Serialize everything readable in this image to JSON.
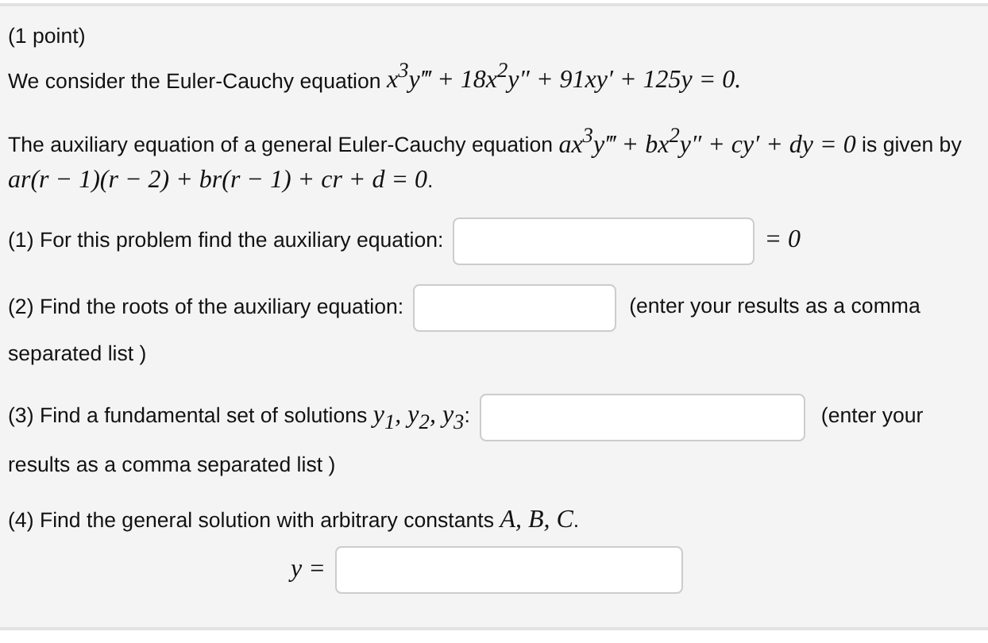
{
  "header": "(1 point)",
  "paragraphs": [
    {
      "parts": [
        {
          "kind": "text",
          "text": "We consider the Euler-Cauchy equation "
        },
        {
          "kind": "math",
          "text": "x$^{3}$y‴ + 18x$^{2}$y″ + 91xy′ + 125y = 0."
        }
      ]
    },
    {
      "parts": [
        {
          "kind": "text",
          "text": "The auxiliary equation of a general Euler-Cauchy equation "
        },
        {
          "kind": "math",
          "text": "ax$^{3}$y‴ + bx$^{2}$y″ + cy′ + dy = 0"
        },
        {
          "kind": "text",
          "text": " is given by "
        },
        {
          "kind": "math",
          "text": "ar(r − 1)(r − 2) + br(r − 1) + cr + d = 0"
        },
        {
          "kind": "text",
          "text": "."
        }
      ]
    }
  ],
  "questions": [
    {
      "kind": "inline",
      "label": [
        {
          "kind": "text",
          "text": "(1) For this problem find the auxiliary equation:"
        }
      ],
      "suffix": {
        "kind": "math",
        "text": "= 0"
      }
    },
    {
      "kind": "inline",
      "label": [
        {
          "kind": "text",
          "text": "(2) Find the roots of the auxiliary equation:"
        }
      ],
      "hint_lines": [
        "(enter your results as a comma",
        "separated list )"
      ]
    },
    {
      "kind": "inline",
      "label": [
        {
          "kind": "text",
          "text": "(3) Find a fundamental set of solutions "
        },
        {
          "kind": "math",
          "text": "y$_{1}$, y$_{2}$, y$_{3}$"
        },
        {
          "kind": "text",
          "text": ":"
        }
      ],
      "hint_lines": [
        "(enter your",
        "results as a comma separated list )"
      ]
    },
    {
      "kind": "block",
      "label": [
        {
          "kind": "text",
          "text": "(4) Find the general solution with arbitrary constants "
        },
        {
          "kind": "math",
          "text": "A, B, C"
        },
        {
          "kind": "text",
          "text": "."
        }
      ],
      "prefix": {
        "kind": "math",
        "text": "y ="
      }
    }
  ]
}
